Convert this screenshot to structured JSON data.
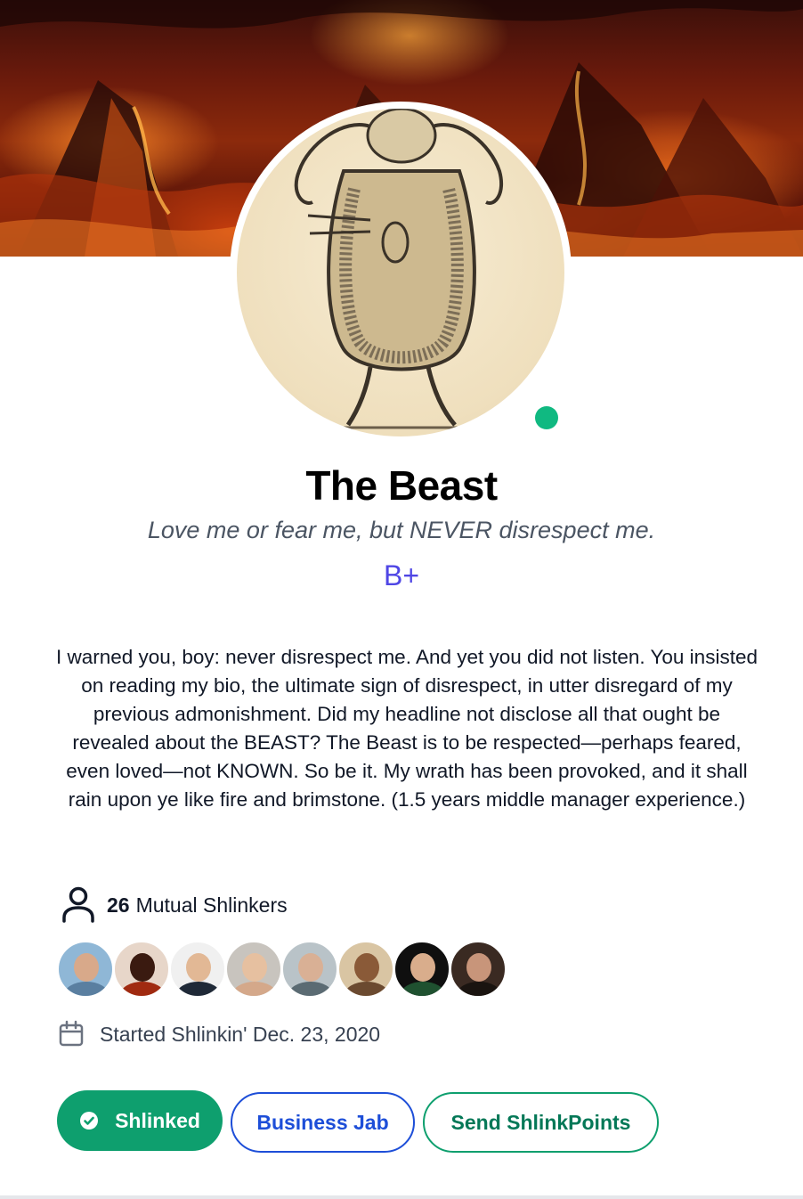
{
  "cover": {
    "icon": "volcano-fire-cover-image"
  },
  "profile": {
    "avatar_icon": "beast-woodcut-avatar",
    "online_status": "online",
    "online_color": "#10b981",
    "name": "The Beast",
    "headline": "Love me or fear me, but NEVER disrespect me.",
    "grade": "B+",
    "grade_color": "#4f46e5",
    "bio": "I warned you, boy: never disrespect me. And yet you did not listen. You insisted on reading my bio, the ultimate sign of disrespect, in utter disregard of my previous admonishment. Did my headline not disclose all that ought be revealed about the BEAST? The Beast is to be respected—perhaps feared, even loved—not KNOWN. So be it. My wrath has been provoked, and it shall rain upon ye like fire and brimstone. (1.5 years middle manager experience.)"
  },
  "mutual": {
    "icon": "user-icon",
    "count": "26",
    "label": "Mutual Shlinkers",
    "avatars": [
      {
        "icon": "mutual-avatar-1"
      },
      {
        "icon": "mutual-avatar-2"
      },
      {
        "icon": "mutual-avatar-3"
      },
      {
        "icon": "mutual-avatar-4"
      },
      {
        "icon": "mutual-avatar-5"
      },
      {
        "icon": "mutual-avatar-6"
      },
      {
        "icon": "mutual-avatar-7"
      },
      {
        "icon": "mutual-avatar-8"
      }
    ]
  },
  "started": {
    "icon": "calendar-icon",
    "text": "Started Shlinkin' Dec. 23, 2020"
  },
  "actions": {
    "shlinked_label": "Shlinked",
    "shlinked_icon": "check-circle-icon",
    "shlinked_color": "#0e9f6e",
    "business_jab_label": "Business Jab",
    "business_jab_color": "#1d4ed8",
    "send_points_label": "Send ShlinkPoints",
    "send_points_color": "#0e9f6e"
  }
}
